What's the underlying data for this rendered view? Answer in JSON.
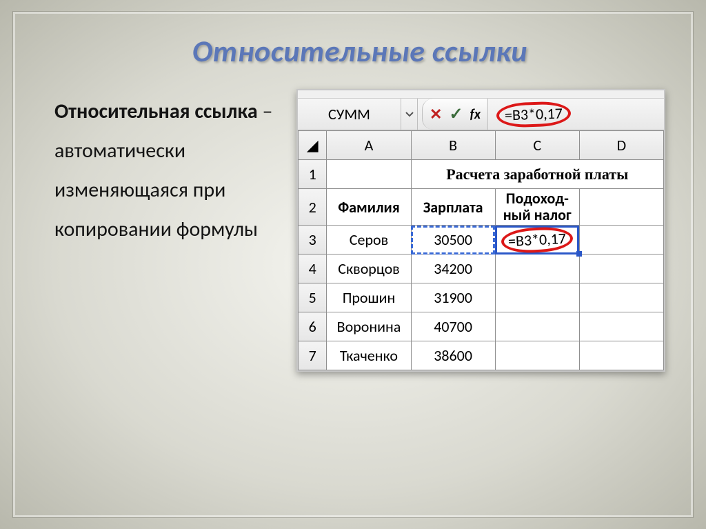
{
  "slide": {
    "title": "Относительные ссылки",
    "definition_term": "Относительная ссылка",
    "definition_rest": " – автоматически изменяющаяся при копировании формулы"
  },
  "excel": {
    "name_box": "СУММ",
    "fx_label": "fx",
    "cancel": "✕",
    "enter": "✓",
    "formula": "=B3*0,17",
    "columns": [
      "A",
      "B",
      "C",
      "D"
    ],
    "title_row": "Расчета заработной платы",
    "headers": {
      "A": "Фамилия",
      "B": "Зарплата",
      "C": "Подоход-\nный налог",
      "D": ""
    },
    "rows": [
      {
        "n": 3,
        "A": "Серов",
        "B": 30500,
        "C": "=B3*0,17"
      },
      {
        "n": 4,
        "A": "Скворцов",
        "B": 34200,
        "C": ""
      },
      {
        "n": 5,
        "A": "Прошин",
        "B": 31900,
        "C": ""
      },
      {
        "n": 6,
        "A": "Воронина",
        "B": 40700,
        "C": ""
      },
      {
        "n": 7,
        "A": "Ткаченко",
        "B": 38600,
        "C": ""
      }
    ]
  },
  "chart_data": {
    "type": "table",
    "title": "Расчета заработной платы",
    "columns": [
      "Фамилия",
      "Зарплата",
      "Подоходный налог"
    ],
    "rows": [
      [
        "Серов",
        30500,
        "=B3*0,17"
      ],
      [
        "Скворцов",
        34200,
        ""
      ],
      [
        "Прошин",
        31900,
        ""
      ],
      [
        "Воронина",
        40700,
        ""
      ],
      [
        "Ткаченко",
        38600,
        ""
      ]
    ],
    "active_cell": "C3",
    "formula_bar": "=B3*0,17",
    "name_box": "СУММ"
  }
}
